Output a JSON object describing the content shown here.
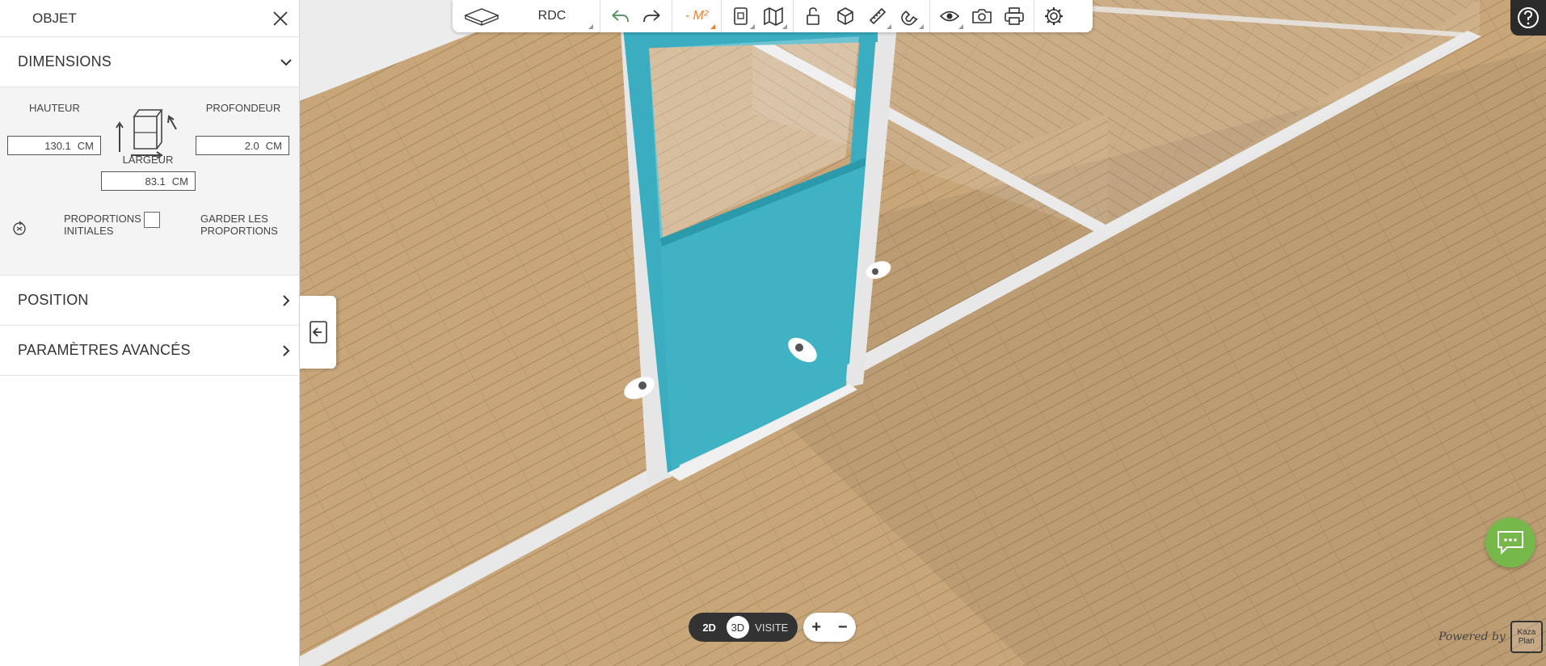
{
  "panel": {
    "title": "OBJET",
    "sections": {
      "dimensions": "DIMENSIONS",
      "position": "POSITION",
      "advanced": "PARAMÈTRES AVANCÉS"
    },
    "dimensions": {
      "height_label": "HAUTEUR",
      "height_value": "130.1",
      "depth_label": "PROFONDEUR",
      "depth_value": "2.0",
      "width_label": "LARGEUR",
      "width_value": "83.1",
      "unit": "CM",
      "initial_proportions_line1": "PROPORTIONS",
      "initial_proportions_line2": "INITIALES",
      "keep_proportions_line1": "GARDER LES",
      "keep_proportions_line2": "PROPORTIONS"
    }
  },
  "toolbar": {
    "level": "RDC",
    "area_label": "- M²"
  },
  "view_mode": {
    "mode_2d": "2D",
    "mode_3d": "3D",
    "mode_visit": "VISITE",
    "active": "3D"
  },
  "zoom": {
    "in": "+",
    "out": "−"
  },
  "footer": {
    "powered_text": "Powered by",
    "logo_line1": "Kaza",
    "logo_line2": "Plan"
  },
  "colors": {
    "accent_orange": "#f07c2a",
    "door_teal": "#3aaec0",
    "chat_green": "#76b84a",
    "floor_wood": "#c9a97d"
  }
}
